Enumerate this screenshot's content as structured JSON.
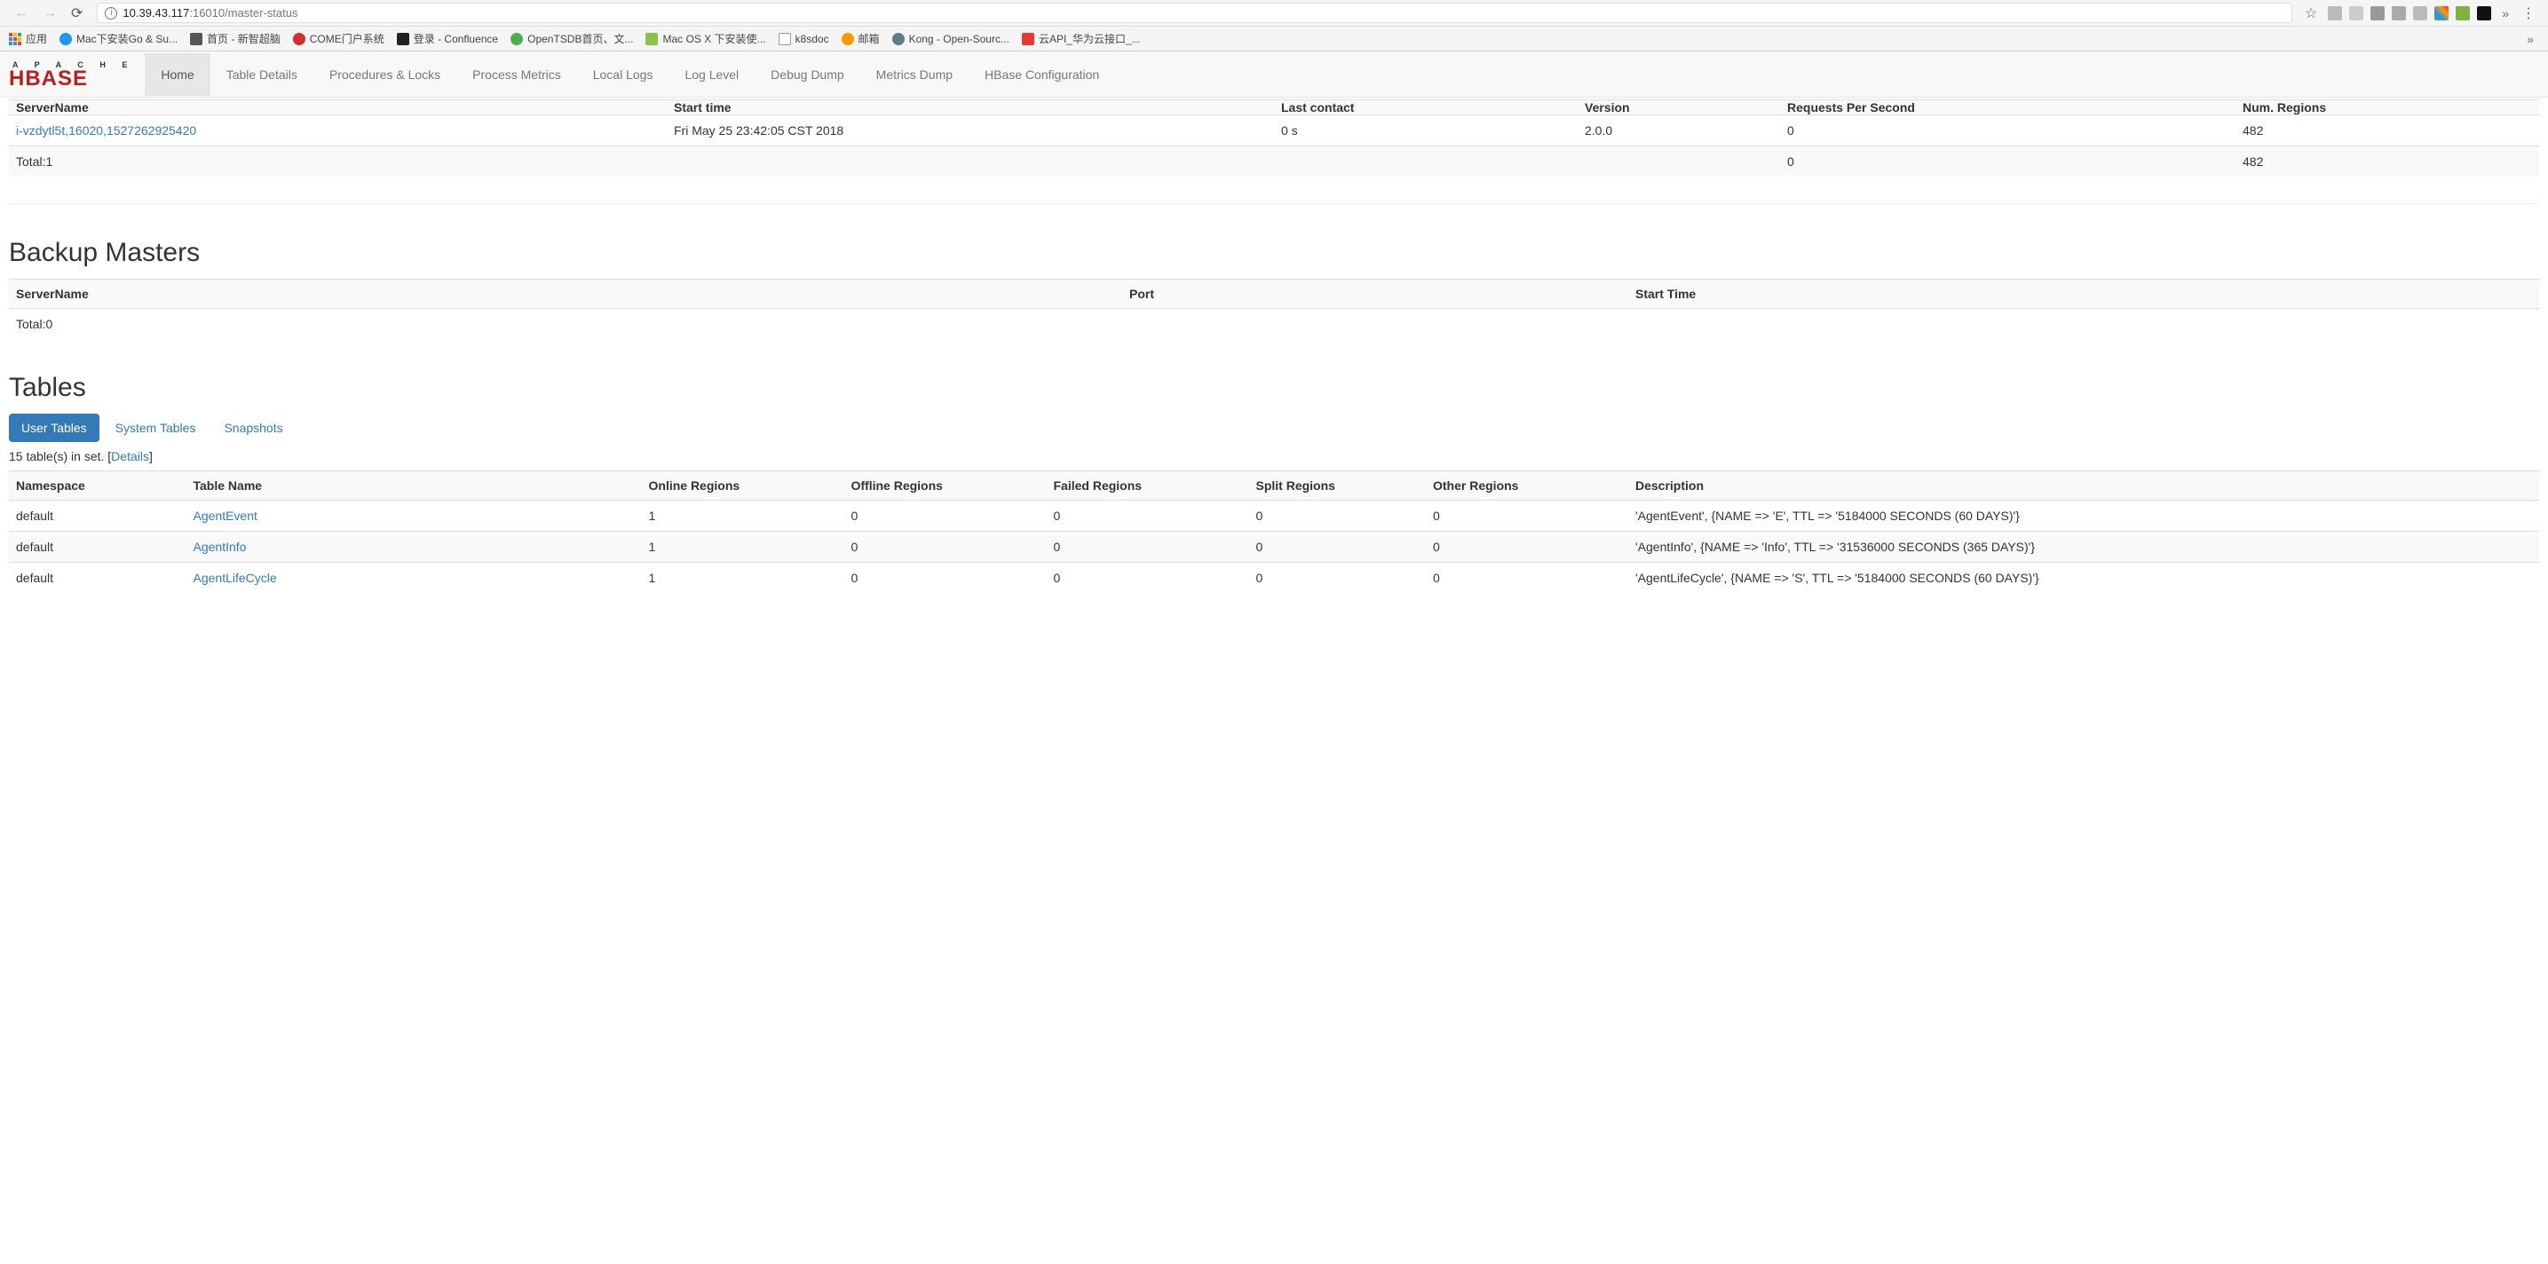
{
  "browser": {
    "url_host": "10.39.43.117",
    "url_port": ":16010",
    "url_path": "/master-status"
  },
  "bookmarks": {
    "apps": "应用",
    "items": [
      {
        "label": "Mac下安装Go & Su...",
        "color": "#2196f3"
      },
      {
        "label": "首页 - 新智超脑",
        "color": "#555"
      },
      {
        "label": "COME门户系统",
        "color": "#d32f2f"
      },
      {
        "label": "登录 - Confluence",
        "color": "#222"
      },
      {
        "label": "OpenTSDB首页、文...",
        "color": "#4caf50"
      },
      {
        "label": "Mac OS X 下安装使...",
        "color": "#8bc34a"
      },
      {
        "label": "k8sdoc",
        "color": "#888"
      },
      {
        "label": "邮箱",
        "color": "#ff9800"
      },
      {
        "label": "Kong - Open-Sourc...",
        "color": "#607d8b"
      },
      {
        "label": "云API_华为云接口_...",
        "color": "#e53935"
      }
    ]
  },
  "logo": {
    "apache": "A P A C H E",
    "hbase": "HBASE"
  },
  "nav": {
    "items": [
      "Home",
      "Table Details",
      "Procedures & Locks",
      "Process Metrics",
      "Local Logs",
      "Log Level",
      "Debug Dump",
      "Metrics Dump",
      "HBase Configuration"
    ],
    "active": 0
  },
  "region_servers": {
    "headers": [
      "ServerName",
      "Start time",
      "Last contact",
      "Version",
      "Requests Per Second",
      "Num. Regions"
    ],
    "rows": [
      {
        "server": "i-vzdytl5t,16020,1527262925420",
        "start": "Fri May 25 23:42:05 CST 2018",
        "contact": "0 s",
        "version": "2.0.0",
        "rps": "0",
        "regions": "482"
      }
    ],
    "total": {
      "label": "Total:1",
      "rps": "0",
      "regions": "482"
    }
  },
  "backup": {
    "title": "Backup Masters",
    "headers": [
      "ServerName",
      "Port",
      "Start Time"
    ],
    "total": "Total:0"
  },
  "tables": {
    "title": "Tables",
    "tabs": [
      "User Tables",
      "System Tables",
      "Snapshots"
    ],
    "active": 0,
    "summary_prefix": "15 table(s) in set. [",
    "summary_link": "Details",
    "summary_suffix": "]",
    "headers": [
      "Namespace",
      "Table Name",
      "Online Regions",
      "Offline Regions",
      "Failed Regions",
      "Split Regions",
      "Other Regions",
      "Description"
    ],
    "rows": [
      {
        "ns": "default",
        "name": "AgentEvent",
        "online": "1",
        "offline": "0",
        "failed": "0",
        "split": "0",
        "other": "0",
        "desc": "'AgentEvent', {NAME => 'E', TTL => '5184000 SECONDS (60 DAYS)'}"
      },
      {
        "ns": "default",
        "name": "AgentInfo",
        "online": "1",
        "offline": "0",
        "failed": "0",
        "split": "0",
        "other": "0",
        "desc": "'AgentInfo', {NAME => 'Info', TTL => '31536000 SECONDS (365 DAYS)'}"
      },
      {
        "ns": "default",
        "name": "AgentLifeCycle",
        "online": "1",
        "offline": "0",
        "failed": "0",
        "split": "0",
        "other": "0",
        "desc": "'AgentLifeCycle', {NAME => 'S', TTL => '5184000 SECONDS (60 DAYS)'}"
      }
    ]
  },
  "watermark": ""
}
